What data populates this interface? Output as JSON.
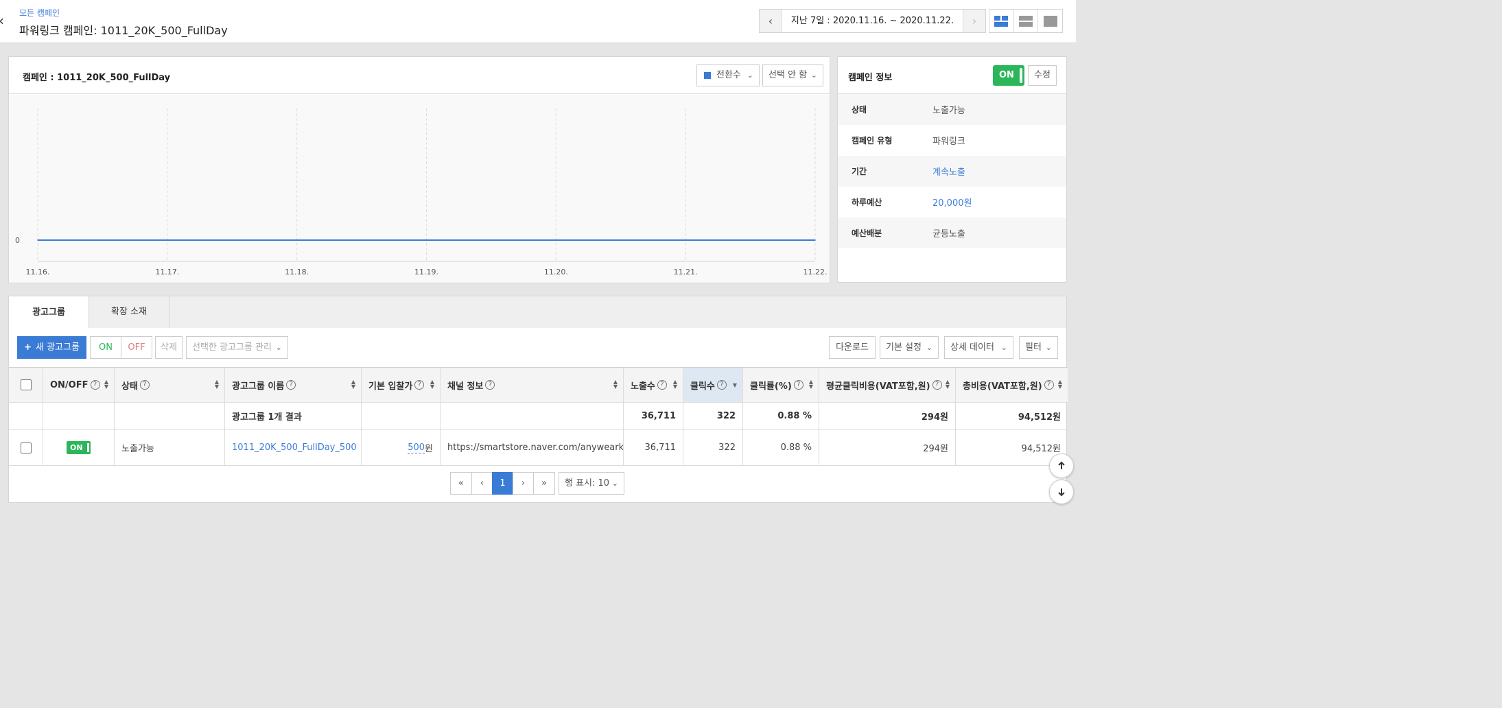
{
  "header": {
    "back_icon": "chevron-left-icon",
    "breadcrumb": "모든 캠페인",
    "title": "파워링크 캠페인: 1011_20K_500_FullDay",
    "date_range": "지난 7일 : 2020.11.16. ~ 2020.11.22.",
    "view_modes": [
      "split-view-icon",
      "list-view-icon",
      "single-view-icon"
    ]
  },
  "chart_panel": {
    "title": "캠페인 : 1011_20K_500_FullDay",
    "metric_select": "전환수",
    "metric_color": "#3a7bd5",
    "compare_select": "선택 안 함"
  },
  "chart_data": {
    "type": "line",
    "x": [
      "11.16.",
      "11.17.",
      "11.18.",
      "11.19.",
      "11.20.",
      "11.21.",
      "11.22."
    ],
    "series": [
      {
        "name": "전환수",
        "values": [
          0,
          0,
          0,
          0,
          0,
          0,
          0
        ]
      }
    ],
    "y_ticks": [
      "0"
    ],
    "grid": "vertical dashed"
  },
  "info_panel": {
    "title": "캠페인 정보",
    "toggle": "ON",
    "edit": "수정",
    "rows": [
      {
        "key": "상태",
        "value": "노출가능"
      },
      {
        "key": "캠페인 유형",
        "value": "파워링크"
      },
      {
        "key": "기간",
        "value": "계속노출"
      },
      {
        "key": "하루예산",
        "value": "20,000원"
      },
      {
        "key": "예산배분",
        "value": "균등노출"
      }
    ]
  },
  "tabs": [
    "광고그룹",
    "확장 소재"
  ],
  "toolbar": {
    "new_group": "새 광고그룹",
    "on": "ON",
    "off": "OFF",
    "delete": "삭제",
    "manage": "선택한 광고그룹 관리",
    "download": "다운로드",
    "basic_settings": "기본 설정",
    "detail_data": "상세 데이터",
    "filter": "필터"
  },
  "table": {
    "headers": {
      "onoff": "ON/OFF",
      "status": "상태",
      "name": "광고그룹 이름",
      "bid": "기본 입찰가",
      "channel": "채널 정보",
      "impressions": "노출수",
      "clicks": "클릭수",
      "ctr": "클릭률(%)",
      "cpc": "평균클릭비용(VAT포함,원)",
      "cost": "총비용(VAT포함,원)"
    },
    "summary": {
      "label": "광고그룹 1개 결과",
      "impressions": "36,711",
      "clicks": "322",
      "ctr": "0.88 %",
      "cpc": "294원",
      "cost": "94,512원"
    },
    "rows": [
      {
        "toggle": "ON",
        "status": "노출가능",
        "name": "1011_20K_500_FullDay_500",
        "bid_value": "500",
        "bid_unit": "원",
        "channel": "https://smartstore.naver.com/anywearkr",
        "impressions": "36,711",
        "clicks": "322",
        "ctr": "0.88 %",
        "cpc": "294원",
        "cost": "94,512원"
      }
    ]
  },
  "pagination": {
    "first": "«",
    "prev": "‹",
    "current": "1",
    "next": "›",
    "last": "»",
    "rows_per_page": "행 표시: 10"
  }
}
